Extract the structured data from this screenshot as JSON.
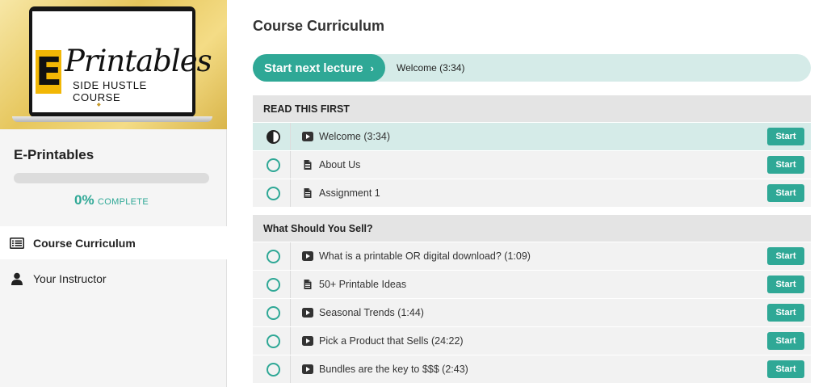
{
  "thumbnail": {
    "logo_letter": "E",
    "logo_word": "Printables",
    "logo_subtitle": "SIDE HUSTLE COURSE",
    "colors": {
      "gold": "#e6c65c",
      "logo_yellow": "#f2b705"
    }
  },
  "sidebar": {
    "course_name": "E-Printables",
    "progress_percent": 0,
    "progress_label_pct": "0%",
    "progress_label_word": "COMPLETE",
    "nav": [
      {
        "label": "Course Curriculum",
        "icon": "curriculum-list-icon",
        "active": true
      },
      {
        "label": "Your Instructor",
        "icon": "user-icon",
        "active": false
      }
    ]
  },
  "main": {
    "title": "Course Curriculum",
    "next_button_label": "Start next lecture",
    "next_button_chevron": "›",
    "next_lecture": "Welcome (3:34)",
    "accent_color": "#2fa896",
    "sections": [
      {
        "title": "READ THIS FIRST",
        "lectures": [
          {
            "title": "Welcome (3:34)",
            "type": "video",
            "status": "in-progress",
            "button": "Start"
          },
          {
            "title": "About Us",
            "type": "text",
            "status": "not-started",
            "button": "Start"
          },
          {
            "title": "Assignment 1",
            "type": "text",
            "status": "not-started",
            "button": "Start"
          }
        ]
      },
      {
        "title": "What Should You Sell?",
        "lectures": [
          {
            "title": "What is a printable OR digital download? (1:09)",
            "type": "video",
            "status": "not-started",
            "button": "Start"
          },
          {
            "title": "50+ Printable Ideas",
            "type": "text",
            "status": "not-started",
            "button": "Start"
          },
          {
            "title": "Seasonal Trends (1:44)",
            "type": "video",
            "status": "not-started",
            "button": "Start"
          },
          {
            "title": "Pick a Product that Sells (24:22)",
            "type": "video",
            "status": "not-started",
            "button": "Start"
          },
          {
            "title": "Bundles are the key to $$$ (2:43)",
            "type": "video",
            "status": "not-started",
            "button": "Start"
          }
        ]
      }
    ]
  }
}
